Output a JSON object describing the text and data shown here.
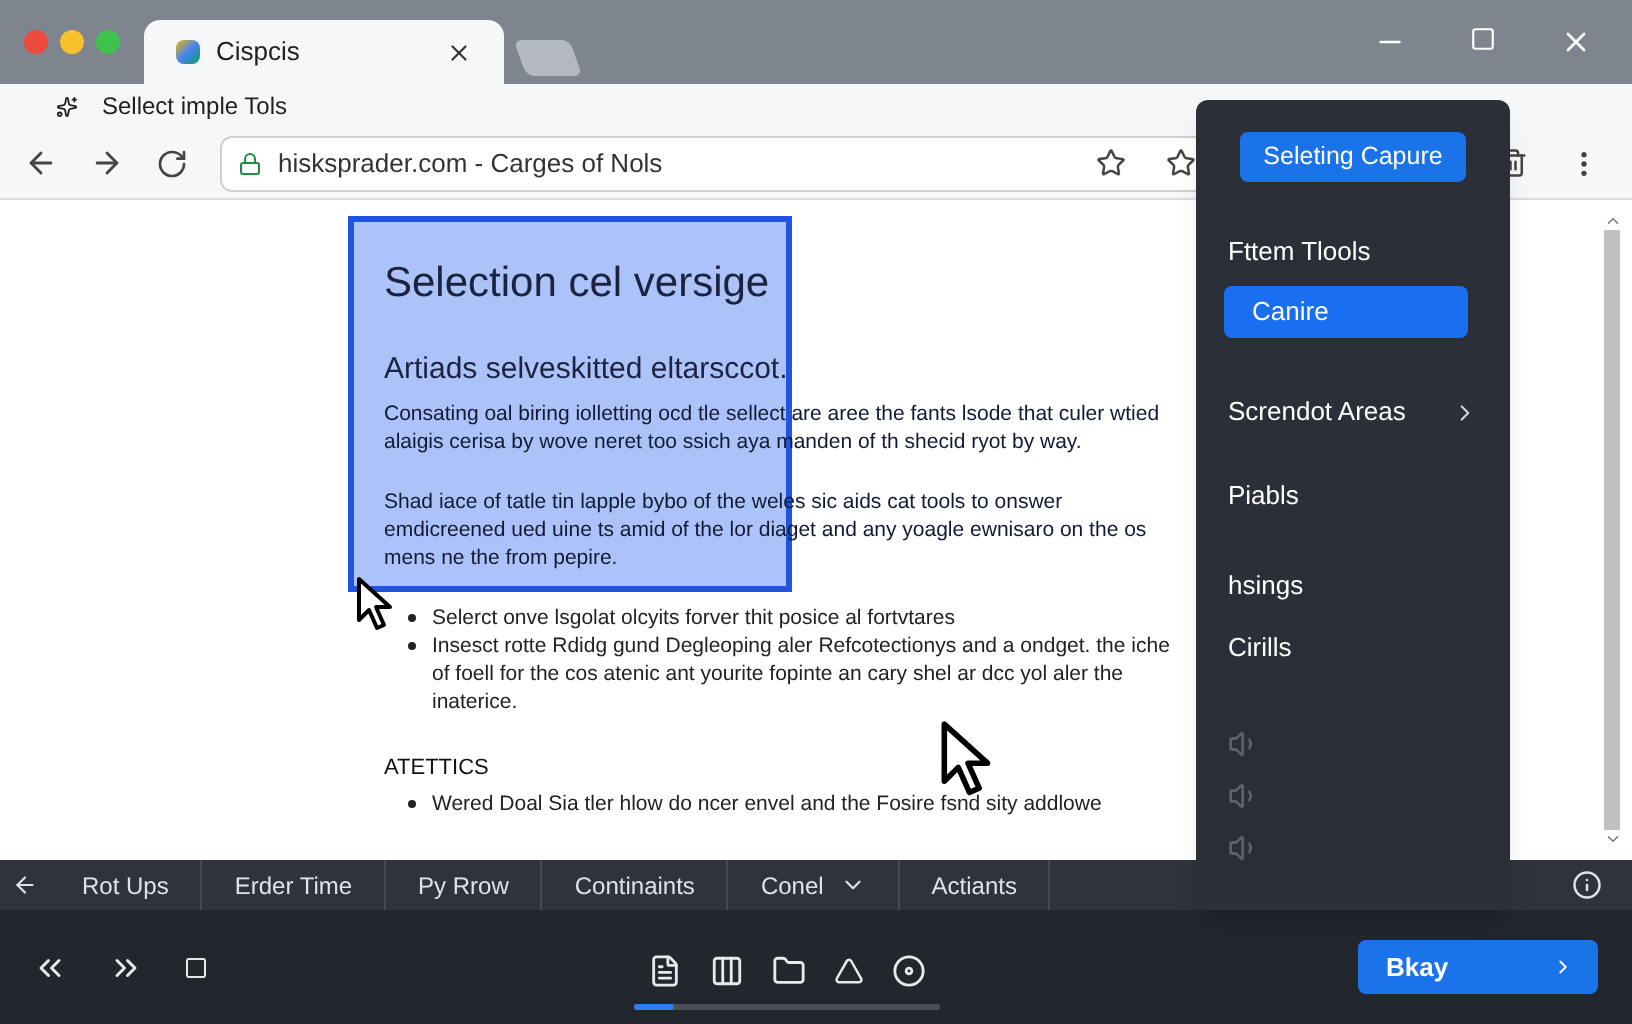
{
  "tabs": [
    {
      "title": "Cispcis",
      "selected": true
    }
  ],
  "bookmarks": [
    {
      "label": "Sellect imple Tols"
    }
  ],
  "address_bar": {
    "url": "hisksprader.com - Carges of Nols"
  },
  "document": {
    "heading": "Selection cel versige",
    "subheading": "Artiads selveskitted eltarsccot.",
    "paragraphs": [
      "Consating oal biring iolletting ocd tle sellect are aree the fants lsode that culer wtied alaigis cerisa by wove neret too ssich aya manden of th shecid ryot by way.",
      "Shad iace of tatle tin lapple bybo of the weles sic aids cat tools to onswer emdicreened ued uine ts amid of the lor diaget and any yoagle ewnisaro on the os mens ne the from pepire."
    ],
    "bullets": [
      "Selerct onve lsgolat olcyits forver thit posice al fortvtares",
      "Insesct rotte Rdidg gund Degleoping aler Refcotectionys and a ondget. the iche of foell for the cos atenic ant yourite fopinte an cary shel ar dcc yol aler the inaterice."
    ],
    "section_heading": "ATETTICS",
    "section_bullets": [
      "Wered Doal Sia tler hlow do ncer envel and the Fosire fsnd sity addlowe"
    ]
  },
  "menu": {
    "button": "Seleting Capure",
    "items": [
      {
        "label": "Fttem Tlools",
        "selected": false,
        "submenu": false
      },
      {
        "label": "Canire",
        "selected": true,
        "submenu": false
      },
      {
        "label": "Screndot Areas",
        "selected": false,
        "submenu": true
      },
      {
        "label": "Piabls",
        "selected": false,
        "submenu": false
      },
      {
        "label": "hsings",
        "selected": false,
        "submenu": false
      },
      {
        "label": "Cirills",
        "selected": false,
        "submenu": false
      }
    ]
  },
  "toolbar": {
    "items": [
      {
        "label": "Rot Ups",
        "kind": "plain"
      },
      {
        "label": "Erder Time",
        "kind": "plain"
      },
      {
        "label": "Py Rrow",
        "kind": "plain"
      },
      {
        "label": "Continaints",
        "kind": "plain"
      },
      {
        "label": "Conel",
        "kind": "dropdown"
      },
      {
        "label": "Actiants",
        "kind": "plain"
      }
    ]
  },
  "player": {
    "progress": {
      "level": 0.13
    },
    "primary_button": "Bkay"
  }
}
